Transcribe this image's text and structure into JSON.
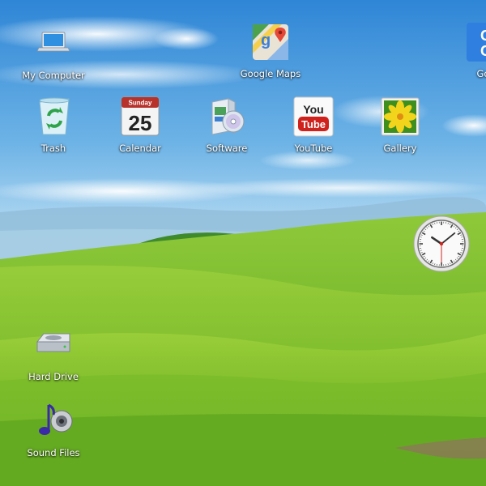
{
  "desktop": {
    "icons": [
      {
        "id": "my-computer",
        "label": "My Computer",
        "icon": "laptop-icon"
      },
      {
        "id": "google-maps",
        "label": "Google Maps",
        "icon": "google-maps-icon"
      },
      {
        "id": "google",
        "label": "Goo",
        "icon": "google-icon"
      },
      {
        "id": "trash",
        "label": "Trash",
        "icon": "recycle-bin-icon"
      },
      {
        "id": "calendar",
        "label": "Calendar",
        "icon": "calendar-icon",
        "day": "Sunday",
        "date": "25"
      },
      {
        "id": "software",
        "label": "Software",
        "icon": "software-box-icon"
      },
      {
        "id": "youtube",
        "label": "YouTube",
        "icon": "youtube-icon",
        "logo_top": "You",
        "logo_bottom": "Tube"
      },
      {
        "id": "gallery",
        "label": "Gallery",
        "icon": "gallery-flower-icon"
      },
      {
        "id": "hard-drive",
        "label": "Hard Drive",
        "icon": "hard-drive-icon"
      },
      {
        "id": "sound-files",
        "label": "Sound Files",
        "icon": "music-note-speaker-icon"
      }
    ],
    "widgets": {
      "clock": {
        "icon": "analog-clock-icon",
        "hour": 10,
        "minute": 8,
        "second": 30
      }
    }
  },
  "colors": {
    "sky_top": "#2f86d6",
    "sky_bottom": "#bfe0f4",
    "grass_light": "#9ed03a",
    "grass_dark": "#4f9a16"
  }
}
